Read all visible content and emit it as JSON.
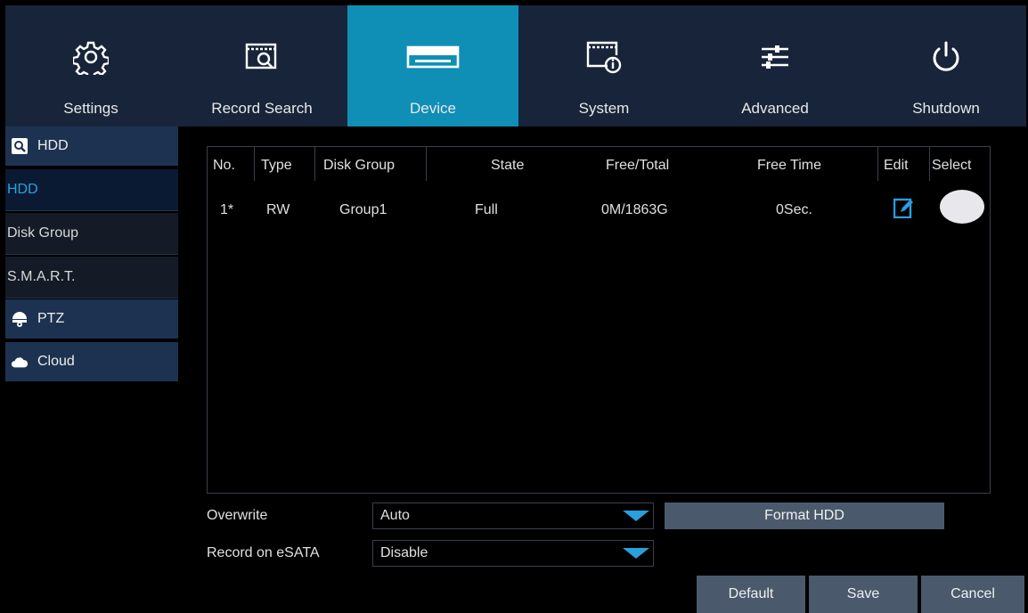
{
  "nav": {
    "tabs": [
      {
        "label": "Settings",
        "icon": "gear-icon"
      },
      {
        "label": "Record Search",
        "icon": "record-search-icon"
      },
      {
        "label": "Device",
        "icon": "hdd-device-icon",
        "active": true
      },
      {
        "label": "System",
        "icon": "system-info-icon"
      },
      {
        "label": "Advanced",
        "icon": "sliders-icon"
      },
      {
        "label": "Shutdown",
        "icon": "power-icon"
      }
    ]
  },
  "sidebar": {
    "hdd_header": "HDD",
    "items": [
      "HDD",
      "Disk Group",
      "S.M.A.R.T."
    ],
    "ptz_header": "PTZ",
    "cloud_header": "Cloud"
  },
  "table": {
    "headers": [
      "No.",
      "Type",
      "Disk Group",
      "State",
      "Free/Total",
      "Free Time",
      "Edit",
      "Select"
    ],
    "rows": [
      {
        "no": "1*",
        "type": "RW",
        "group": "Group1",
        "state": "Full",
        "free_total": "0M/1863G",
        "free_time": "0Sec."
      }
    ]
  },
  "form": {
    "overwrite_label": "Overwrite",
    "overwrite_value": "Auto",
    "esata_label": "Record on eSATA",
    "esata_value": "Disable",
    "format_button": "Format HDD"
  },
  "footer": {
    "default": "Default",
    "save": "Save",
    "cancel": "Cancel"
  },
  "colors": {
    "accent": "#0f8fb6",
    "topbar": "#17243a",
    "sidebar_header": "#1c3250",
    "button": "#4a5a6c"
  }
}
